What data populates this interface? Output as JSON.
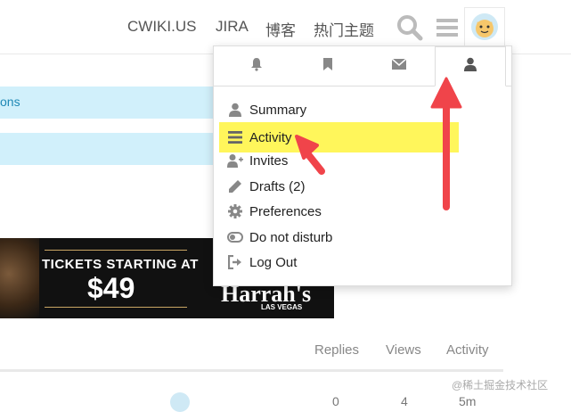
{
  "header": {
    "nav": [
      "CWIKI.US",
      "JIRA",
      "博客",
      "热门主题"
    ],
    "icons": {
      "search": "search-icon",
      "menu": "hamburger-menu-icon",
      "avatar": "avatar"
    }
  },
  "background": {
    "bar1_text": "ons",
    "ad": {
      "headline": "TICKETS STARTING AT",
      "price": "$49",
      "brand": "Harrah's",
      "city": "LAS VEGAS"
    },
    "table": {
      "columns": [
        "Replies",
        "Views",
        "Activity"
      ],
      "row": {
        "replies": "0",
        "views": "4",
        "activity": "5m"
      }
    },
    "watermark": "@稀土掘金技术社区"
  },
  "user_menu": {
    "tabs": [
      {
        "icon": "bell-icon"
      },
      {
        "icon": "bookmark-icon"
      },
      {
        "icon": "envelope-icon"
      },
      {
        "icon": "user-icon",
        "active": true
      }
    ],
    "items": [
      {
        "label": "Summary",
        "icon": "user-icon"
      },
      {
        "label": "Activity",
        "icon": "stream-icon",
        "highlighted": true
      },
      {
        "label": "Invites",
        "icon": "user-plus-icon"
      },
      {
        "label": "Drafts (2)",
        "icon": "pencil-icon"
      },
      {
        "label": "Preferences",
        "icon": "gear-icon"
      },
      {
        "label": "Do not disturb",
        "icon": "toggle-off-icon"
      },
      {
        "label": "Log Out",
        "icon": "sign-out-icon"
      }
    ]
  },
  "colors": {
    "highlight": "#fff65b",
    "annotation_arrow": "#f0444a",
    "link": "#1e88b5",
    "banner": "#d1f0fb"
  }
}
